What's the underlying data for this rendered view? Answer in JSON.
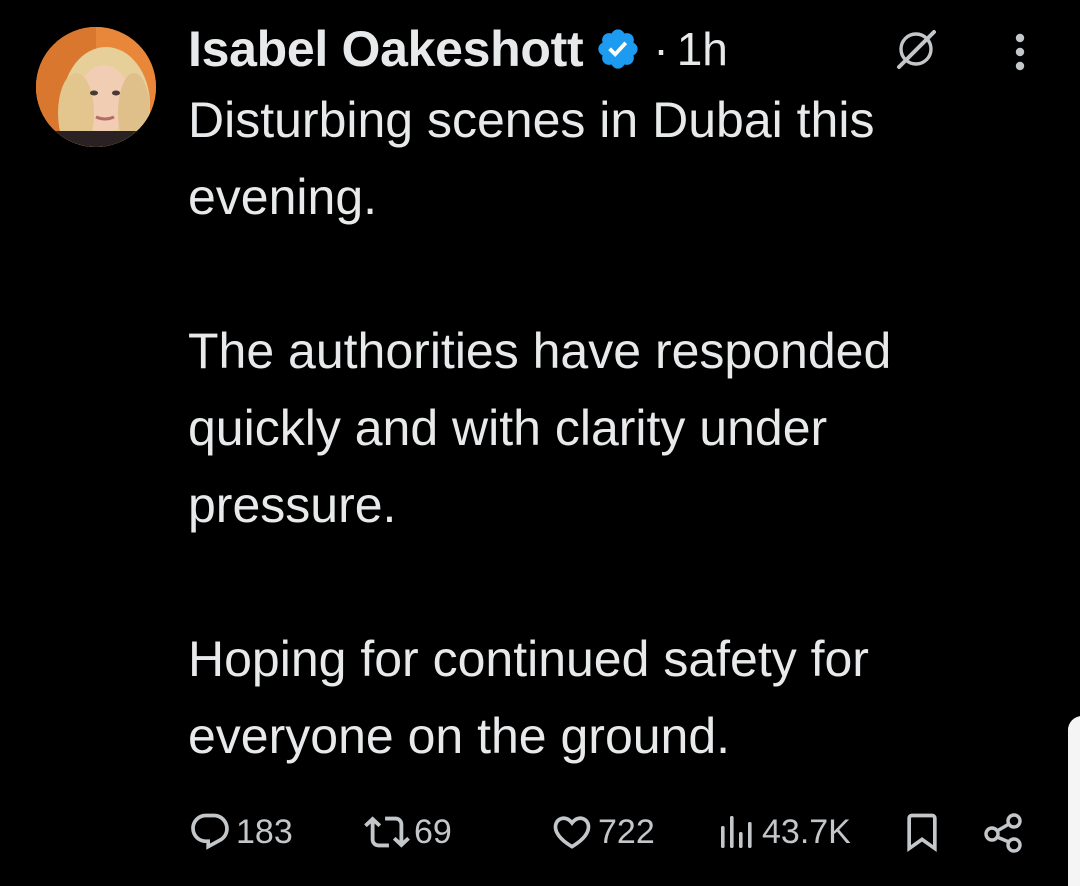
{
  "author": {
    "name": "Isabel Oakeshott",
    "verified": true,
    "separator": "·",
    "time": "1h"
  },
  "icons": {
    "avatar": "profile-photo",
    "verified": "verified-badge-icon",
    "grok": "grok-icon",
    "more": "more-vertical-icon",
    "reply": "reply-icon",
    "repost": "repost-icon",
    "like": "heart-icon",
    "views": "views-icon",
    "bookmark": "bookmark-icon",
    "share": "share-icon"
  },
  "tweet": {
    "text": "Disturbing scenes in Dubai this\nevening.\n\nThe authorities have responded\nquickly and with clarity under\npressure.\n\nHoping for continued safety for\neveryone on the ground."
  },
  "stats": {
    "replies": "183",
    "reposts": "69",
    "likes": "722",
    "views": "43.7K"
  },
  "colors": {
    "background": "#000000",
    "text": "#e7e9ea",
    "muted": "#c4c7ca",
    "verified": "#1d9bf0"
  }
}
